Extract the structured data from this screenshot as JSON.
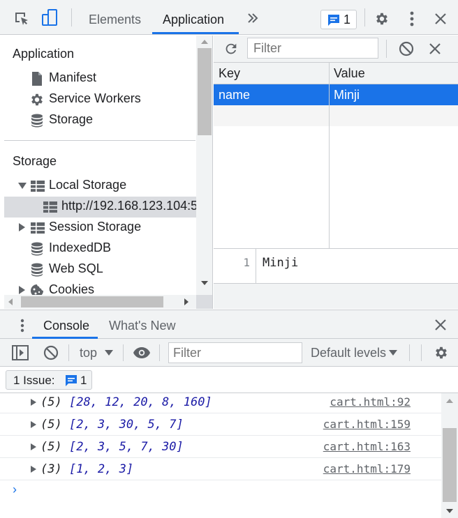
{
  "topbar": {
    "tabs": [
      {
        "label": "Elements",
        "active": false
      },
      {
        "label": "Application",
        "active": true
      }
    ],
    "more_tabs_icon": "double-chevron-icon",
    "issues_count": "1"
  },
  "sidebar": {
    "application_title": "Application",
    "application_items": [
      {
        "label": "Manifest",
        "icon": "document-icon"
      },
      {
        "label": "Service Workers",
        "icon": "gear-icon"
      },
      {
        "label": "Storage",
        "icon": "database-icon"
      }
    ],
    "storage_title": "Storage",
    "storage_items": [
      {
        "label": "Local Storage",
        "icon": "table-icon",
        "expanded": true
      },
      {
        "label": "http://192.168.123.104:5",
        "icon": "table-icon",
        "selected": true
      },
      {
        "label": "Session Storage",
        "icon": "table-icon",
        "expanded": false
      },
      {
        "label": "IndexedDB",
        "icon": "database-icon"
      },
      {
        "label": "Web SQL",
        "icon": "database-icon"
      },
      {
        "label": "Cookies",
        "icon": "cookie-icon",
        "expanded": false
      }
    ]
  },
  "storage_view": {
    "filter_placeholder": "Filter",
    "columns": [
      "Key",
      "Value"
    ],
    "rows": [
      {
        "key": "name",
        "value": "Minji"
      }
    ],
    "preview": {
      "line_number": "1",
      "value": "Minji"
    }
  },
  "drawer": {
    "tabs": [
      {
        "label": "Console",
        "active": true
      },
      {
        "label": "What's New",
        "active": false
      }
    ]
  },
  "console_toolbar": {
    "context": "top",
    "filter_placeholder": "Filter",
    "levels": "Default levels"
  },
  "issues_bar": {
    "label": "1 Issue:",
    "count": "1"
  },
  "console": {
    "logs": [
      {
        "count": "(5)",
        "array": "[28, 12, 20, 8, 160]",
        "source": "cart.html:92"
      },
      {
        "count": "(5)",
        "array": "[2, 3, 30, 5, 7]",
        "source": "cart.html:159"
      },
      {
        "count": "(5)",
        "array": "[2, 3, 5, 7, 30]",
        "source": "cart.html:163"
      },
      {
        "count": "(3)",
        "array": "[1, 2, 3]",
        "source": "cart.html:179"
      }
    ],
    "prompt": "›"
  },
  "colors": {
    "accent": "#1a73e8",
    "toolbar_bg": "#f1f3f4",
    "selected_row": "#1a73e8"
  }
}
